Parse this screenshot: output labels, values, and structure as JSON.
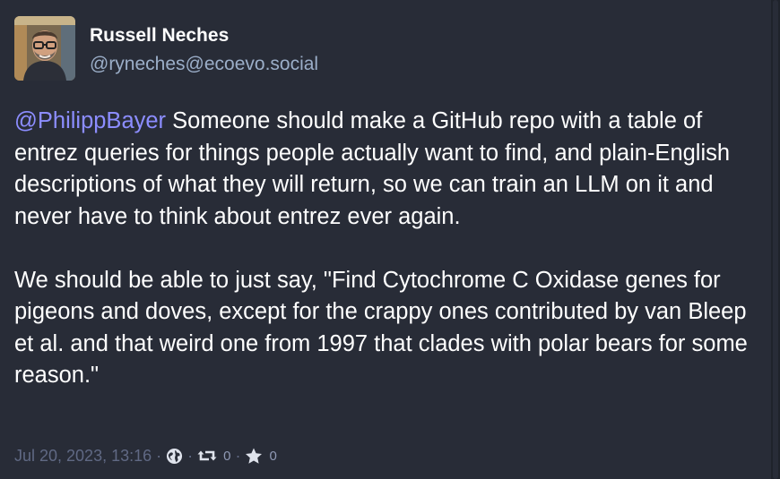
{
  "author": {
    "display_name": "Russell Neches",
    "handle": "@ryneches@ecoevo.social"
  },
  "post": {
    "mention": "@PhilippBayer",
    "paragraph_1": " Someone should make a GitHub repo with a table of entrez queries for things people actually want to find, and plain-English descriptions of what they will return, so we can train an LLM on it and never have to think about entrez ever again.",
    "paragraph_2": "We should be able to just say, \"Find Cytochrome C Oxidase genes for pigeons and doves, except for the crappy ones contributed by van Bleep et al. and that weird one from 1997 that clades with polar bears for some reason.\""
  },
  "meta": {
    "timestamp": "Jul 20, 2023, 13:16",
    "separator": "·",
    "visibility_icon": "globe-icon",
    "reblog_icon": "boost-icon",
    "favourite_icon": "star-icon",
    "reblog_count": "0",
    "favourite_count": "0"
  },
  "colors": {
    "background": "#282c37",
    "text": "#ffffff",
    "handle": "#9baec8",
    "mention": "#8c8dff",
    "meta": "#606984"
  }
}
